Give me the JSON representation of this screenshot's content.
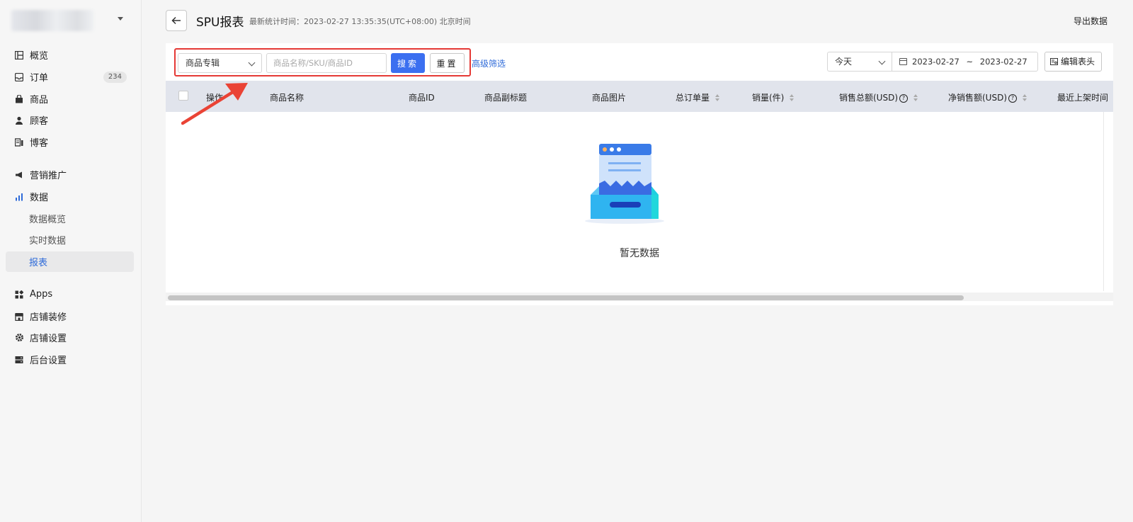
{
  "sidebar": {
    "items": [
      {
        "label": "概览",
        "icon": "overview-icon"
      },
      {
        "label": "订单",
        "icon": "order-icon",
        "badge": "234"
      },
      {
        "label": "商品",
        "icon": "product-icon"
      },
      {
        "label": "顾客",
        "icon": "customer-icon"
      },
      {
        "label": "博客",
        "icon": "blog-icon"
      },
      {
        "label": "营销推广",
        "icon": "marketing-icon"
      },
      {
        "label": "数据",
        "icon": "data-icon"
      },
      {
        "label": "数据概览"
      },
      {
        "label": "实时数据"
      },
      {
        "label": "报表"
      },
      {
        "label": "Apps",
        "icon": "apps-icon"
      },
      {
        "label": "店铺装修",
        "icon": "store-decor-icon"
      },
      {
        "label": "店铺设置",
        "icon": "settings-icon"
      },
      {
        "label": "后台设置",
        "icon": "server-icon"
      }
    ]
  },
  "header": {
    "title": "SPU报表",
    "stat_time": "最新统计时间：2023-02-27 13:35:35(UTC+08:00) 北京时间",
    "export_label": "导出数据"
  },
  "toolbar": {
    "select_value": "商品专辑",
    "search_placeholder": "商品名称/SKU/商品ID",
    "search_label": "搜索",
    "reset_label": "重置",
    "advanced_label": "高级筛选",
    "range_value": "今天",
    "date_start": "2023-02-27",
    "date_sep": "~",
    "date_end": "2023-02-27",
    "edit_header_label": "编辑表头"
  },
  "table": {
    "columns": [
      "操作",
      "商品名称",
      "商品ID",
      "商品副标题",
      "商品图片",
      "总订单量",
      "销量(件)",
      "销售总额(USD)",
      "净销售额(USD)",
      "最近上架时间"
    ],
    "empty_text": "暂无数据"
  },
  "colors": {
    "accent": "#3b6ff0",
    "highlight": "#e53935",
    "table_header": "#e1e4ec"
  }
}
